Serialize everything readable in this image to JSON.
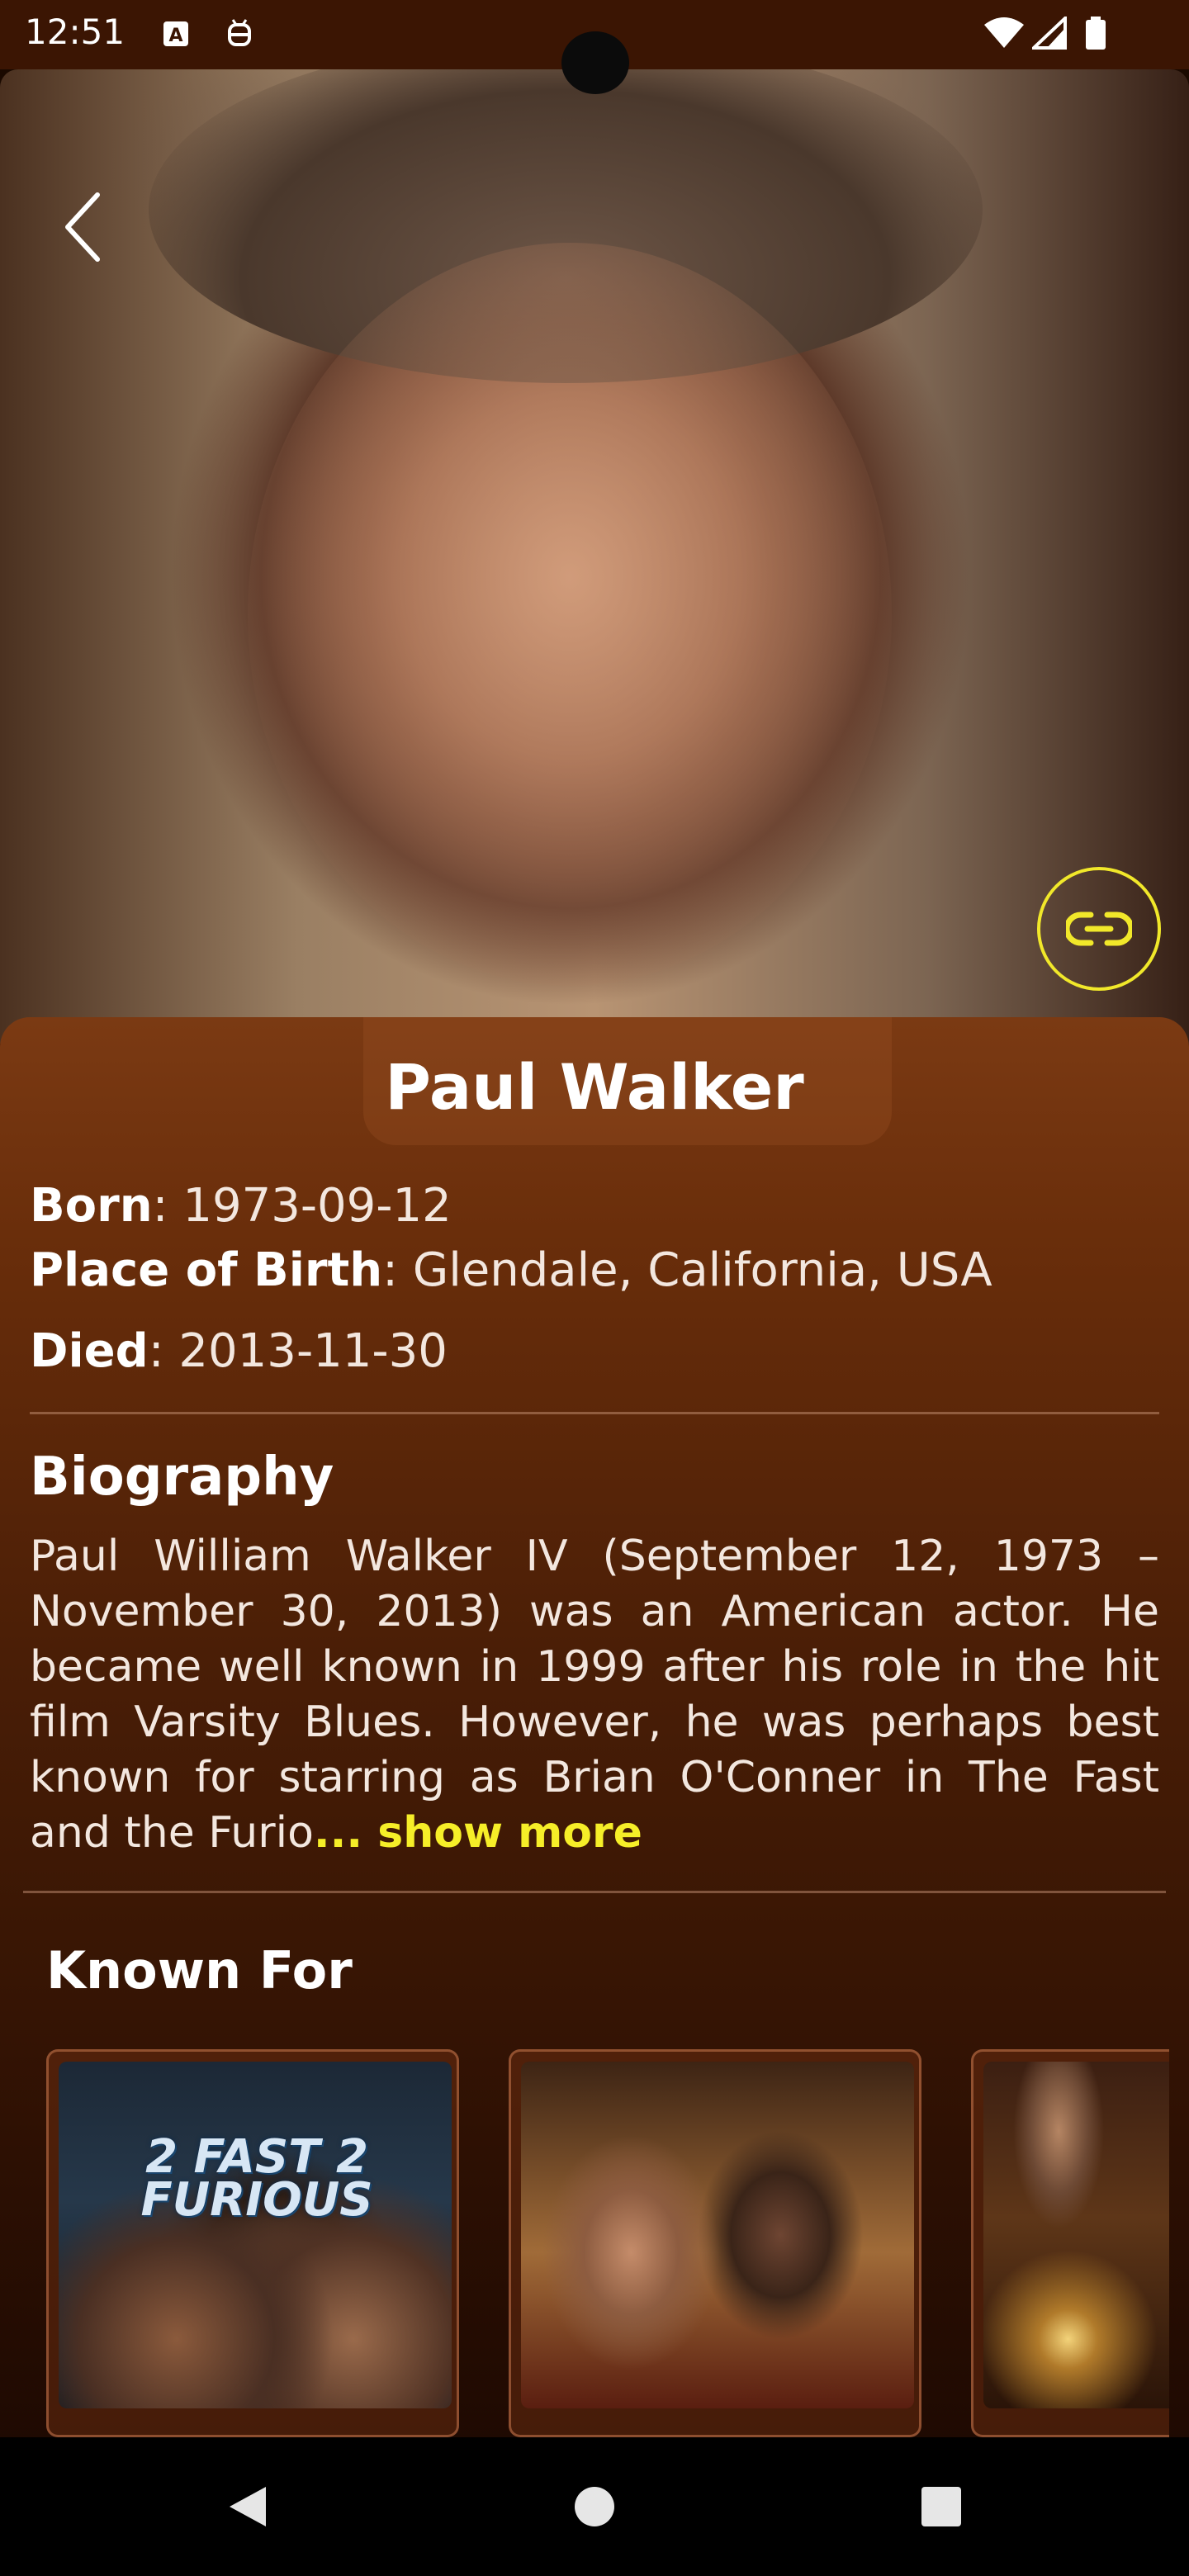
{
  "status_bar": {
    "time": "12:51"
  },
  "actor": {
    "name": "Paul Walker",
    "born_label": "Born",
    "born_value": "1973-09-12",
    "birthplace_label": "Place of Birth",
    "birthplace_value": "Glendale, California, USA",
    "died_label": "Died",
    "died_value": "2013-11-30"
  },
  "biography": {
    "title": "Biography",
    "text": "Paul William Walker IV (September 12, 1973 – November 30, 2013) was an American actor. He became well known in 1999 after his role in the hit film Varsity Blues. However, he was perhaps best known for starring as Brian O'Conner in The Fast and the Furio",
    "show_more": "... show more"
  },
  "known_for": {
    "title": "Known For",
    "poster_1_title": "2 FAST 2 FURIOUS"
  },
  "colors": {
    "accent": "#f6ee28",
    "panel_top": "#7b3a13",
    "panel_bottom": "#1f0a02"
  }
}
